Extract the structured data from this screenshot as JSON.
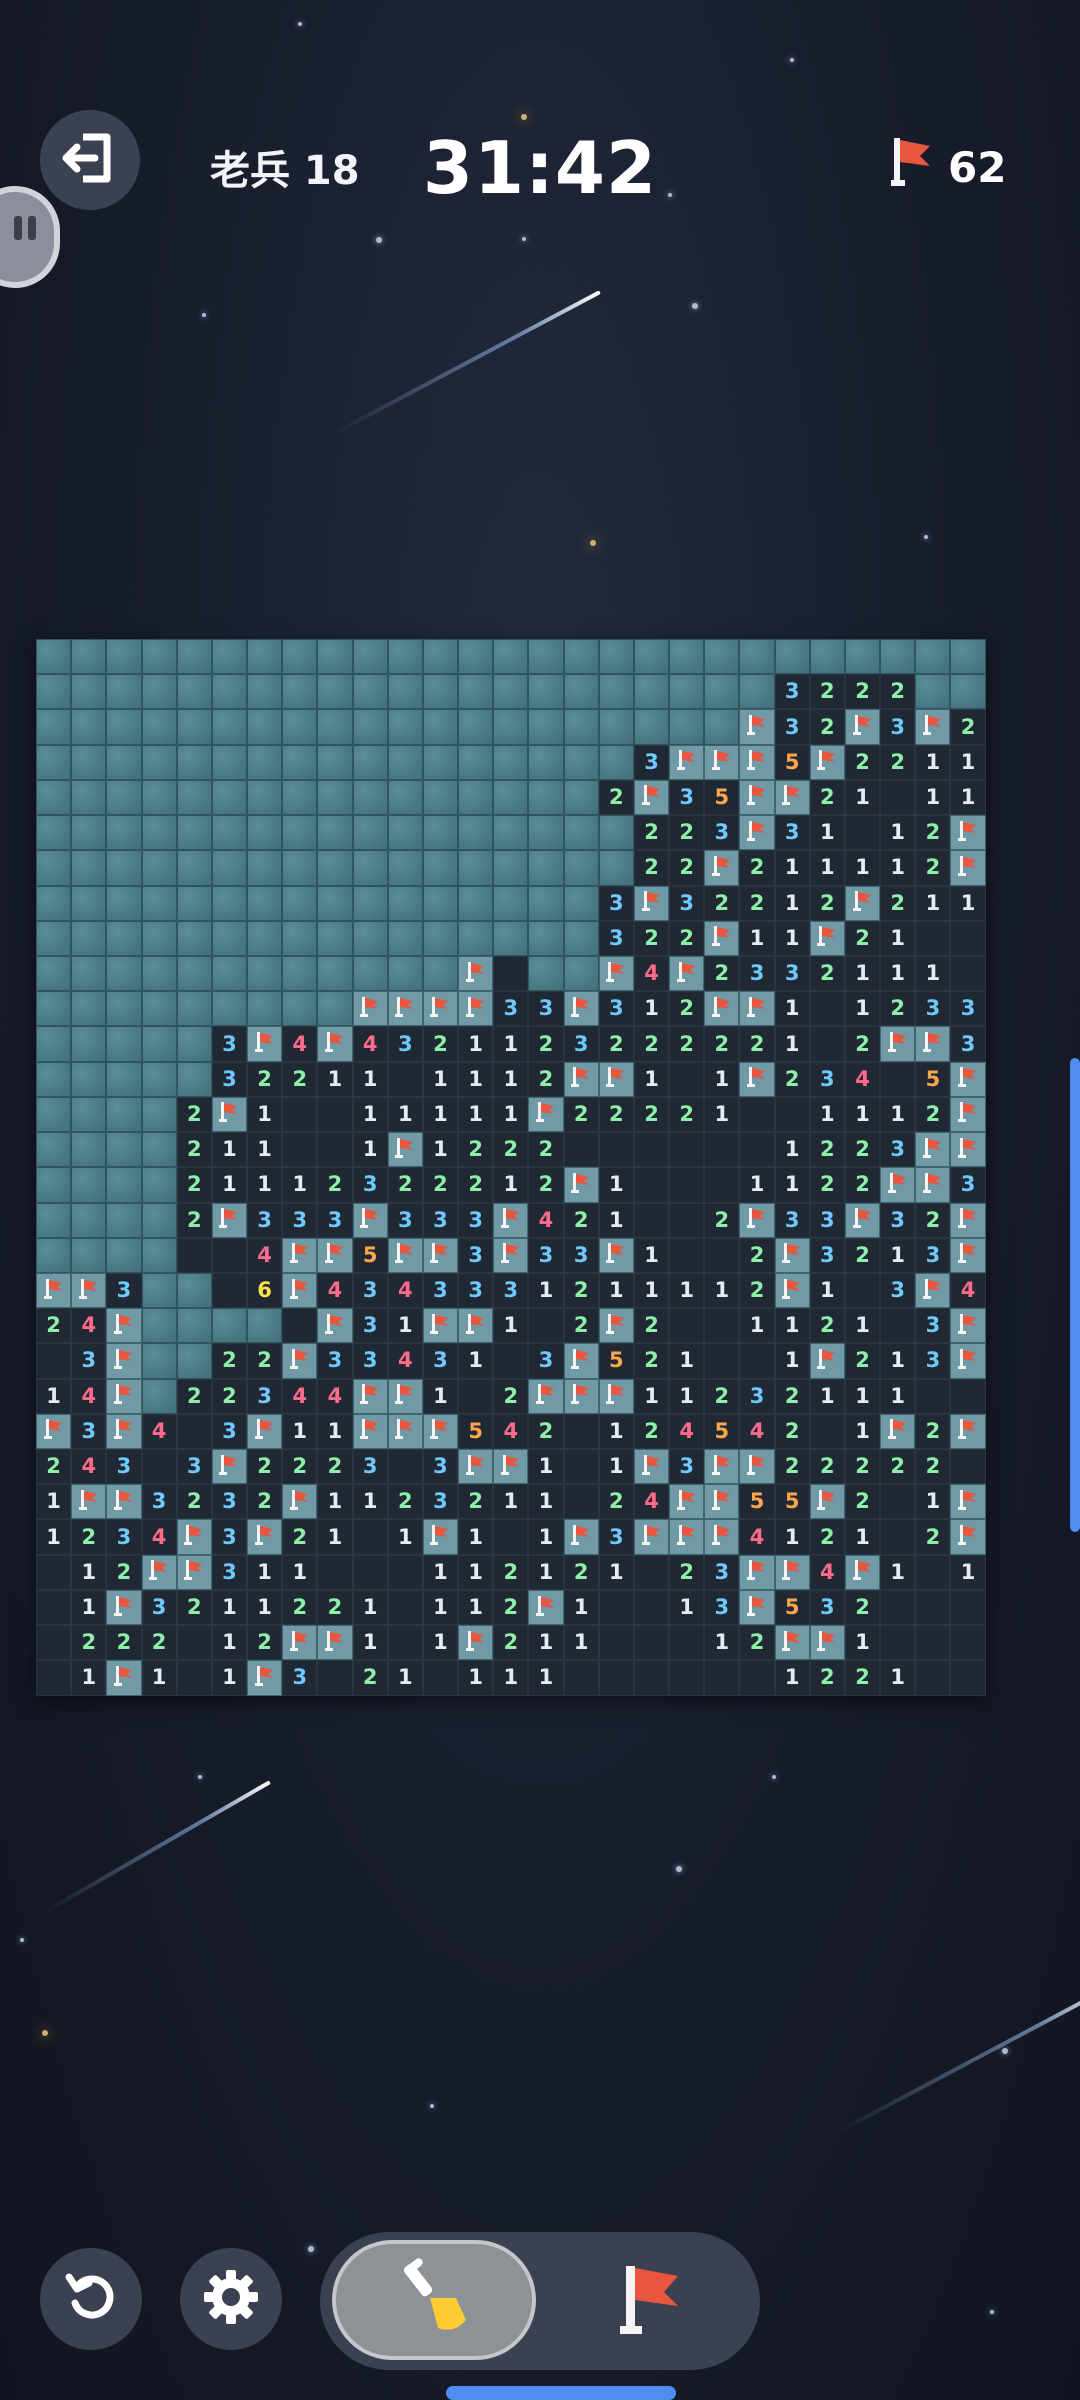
{
  "header": {
    "level_text": "老兵 18",
    "timer": "31:42",
    "flags_remaining": "62"
  },
  "icons": {
    "exit": "exit-icon",
    "pause": "pause-icon",
    "flag": "flag-icon",
    "undo": "undo-icon",
    "settings": "gear-icon",
    "shovel": "shovel-icon"
  },
  "colors": {
    "background": "#171c2a",
    "hidden_tile": "#4a7a86",
    "open_tile": "#1f2833",
    "flag_red": "#e9563f",
    "accent_blue": "#4f8ef0"
  },
  "board": {
    "cols": 27,
    "rows": 30,
    "legend": "H = hidden tile, F = flag, . = open empty, digit = adjacent mine count",
    "rows_data": [
      "HHHHHHHHHHHHHHHHHHHHHHHHHHH",
      "HHHHHHHHHHHHHHHHHHHHH3222HHH",
      "HHHHHHHHHHHHHHHHHHHHF32F3F2",
      "HHHHHHHHHHHHHHHHH3FFF5F2211",
      "HHHHHHHHHHHHHHHH2F35FF21.11",
      "HHHHHHHHHHHHHHHHH223F31.12F",
      "HHHHHHHHHHHHHHHHH22F211112F2",
      "HHHHHHHHHHHHHHHH3F32212F211",
      "HHHHHHHHHHHHHHHH322F11F21..",
      "HHHHHHHHHHHHF HHF4F2332111.11",
      "HHHHHHHHHFFFF33F312FF1.1233F",
      "HHHHH3F4F4321123222221 2FF33",
      "HHHHH32211.1112FF1.1F234 5F",
      "HHHH2F1..11111F22221..1112FF6F",
      "HHHH211..1F1222......1223FFF",
      "HHHH21112322212F1...1122FF335 4",
      "HHHH2F333F333F421..2F33F32FF",
      "HHHH..4FF5FF3F33F1..2F3213F42",
      "FF3HH.6F4343331211112F1.3F41",
      "24FHHHH.F31FF1.2F2..1121 3F4F",
      ".3FHH22F33431.3F521..1F213F",
      "14FH22344FF1.2FFF11232111",
      "F3F4 3F11FFF542.124542 1F2F222",
      "243 3F2223 3FF1.1F3FF22222 3FF",
      "1FF3232F1123211 24FF55F2 1F43",
      "1234F3F21.1F1.1F3FFF4121 2F",
      ".12FF311...112121 23FF4F1 11",
      ".1F3211221.112F1..13F532..",
      ".222.12FF1 1F211...12FF1..",
      ".1F1.1F3 21.111......1221..."
    ]
  }
}
